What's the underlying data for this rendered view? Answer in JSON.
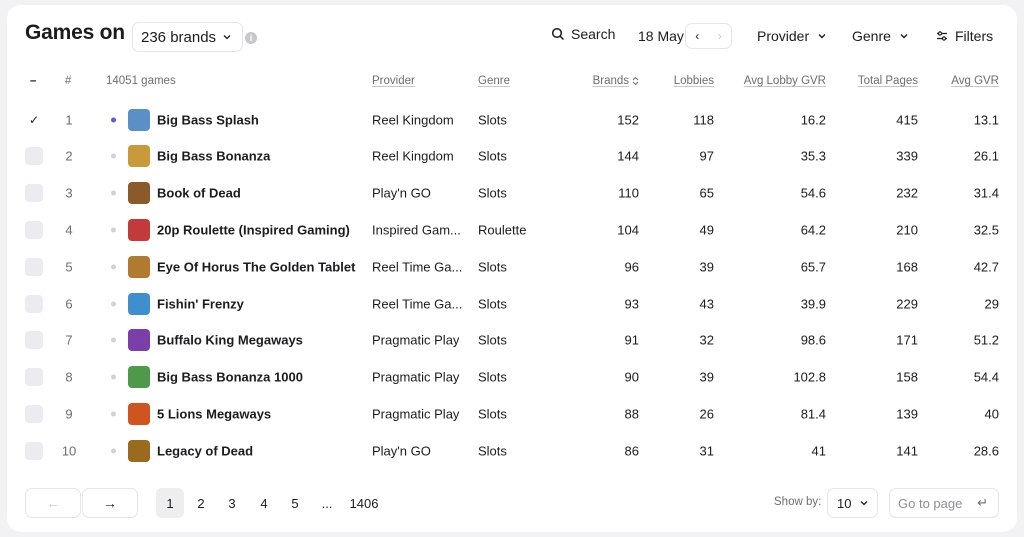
{
  "header": {
    "title": "Games on",
    "brand_select": "236 brands",
    "info_glyph": "i",
    "search_label": "Search",
    "date": "18 May",
    "date_prev": "‹",
    "date_next": "›",
    "provider_label": "Provider",
    "genre_label": "Genre",
    "filters_label": "Filters"
  },
  "table": {
    "columns": {
      "select": "–",
      "rank": "#",
      "games": "14051 games",
      "provider": "Provider",
      "genre": "Genre",
      "brands": "Brands",
      "lobbies": "Lobbies",
      "avg_lobby_gvr": "Avg Lobby GVR",
      "total_pages": "Total Pages",
      "avg_gvr": "Avg GVR"
    },
    "rows": [
      {
        "rank": "1",
        "name": "Big Bass Splash",
        "provider": "Reel Kingdom",
        "genre": "Slots",
        "brands": "152",
        "lobbies": "118",
        "avg_lobby_gvr": "16.2",
        "total_pages": "415",
        "avg_gvr": "13.1",
        "selected": true,
        "thumb": "#5a8fc7"
      },
      {
        "rank": "2",
        "name": "Big Bass Bonanza",
        "provider": "Reel Kingdom",
        "genre": "Slots",
        "brands": "144",
        "lobbies": "97",
        "avg_lobby_gvr": "35.3",
        "total_pages": "339",
        "avg_gvr": "26.1",
        "selected": false,
        "thumb": "#c89a3a"
      },
      {
        "rank": "3",
        "name": "Book of Dead",
        "provider": "Play'n GO",
        "genre": "Slots",
        "brands": "110",
        "lobbies": "65",
        "avg_lobby_gvr": "54.6",
        "total_pages": "232",
        "avg_gvr": "31.4",
        "selected": false,
        "thumb": "#8a5a2a"
      },
      {
        "rank": "4",
        "name": "20p Roulette (Inspired Gaming)",
        "provider": "Inspired Gam...",
        "genre": "Roulette",
        "brands": "104",
        "lobbies": "49",
        "avg_lobby_gvr": "64.2",
        "total_pages": "210",
        "avg_gvr": "32.5",
        "selected": false,
        "thumb": "#c23a3a"
      },
      {
        "rank": "5",
        "name": "Eye Of Horus The Golden Tablet",
        "provider": "Reel Time Ga...",
        "genre": "Slots",
        "brands": "96",
        "lobbies": "39",
        "avg_lobby_gvr": "65.7",
        "total_pages": "168",
        "avg_gvr": "42.7",
        "selected": false,
        "thumb": "#b07a30"
      },
      {
        "rank": "6",
        "name": "Fishin' Frenzy",
        "provider": "Reel Time Ga...",
        "genre": "Slots",
        "brands": "93",
        "lobbies": "43",
        "avg_lobby_gvr": "39.9",
        "total_pages": "229",
        "avg_gvr": "29",
        "selected": false,
        "thumb": "#3f8fcf"
      },
      {
        "rank": "7",
        "name": "Buffalo King Megaways",
        "provider": "Pragmatic Play",
        "genre": "Slots",
        "brands": "91",
        "lobbies": "32",
        "avg_lobby_gvr": "98.6",
        "total_pages": "171",
        "avg_gvr": "51.2",
        "selected": false,
        "thumb": "#7a3fa8"
      },
      {
        "rank": "8",
        "name": "Big Bass Bonanza 1000",
        "provider": "Pragmatic Play",
        "genre": "Slots",
        "brands": "90",
        "lobbies": "39",
        "avg_lobby_gvr": "102.8",
        "total_pages": "158",
        "avg_gvr": "54.4",
        "selected": false,
        "thumb": "#4f9a4a"
      },
      {
        "rank": "9",
        "name": "5 Lions Megaways",
        "provider": "Pragmatic Play",
        "genre": "Slots",
        "brands": "88",
        "lobbies": "26",
        "avg_lobby_gvr": "81.4",
        "total_pages": "139",
        "avg_gvr": "40",
        "selected": false,
        "thumb": "#d0541f"
      },
      {
        "rank": "10",
        "name": "Legacy of Dead",
        "provider": "Play'n GO",
        "genre": "Slots",
        "brands": "86",
        "lobbies": "31",
        "avg_lobby_gvr": "41",
        "total_pages": "141",
        "avg_gvr": "28.6",
        "selected": false,
        "thumb": "#9a6a1e"
      }
    ]
  },
  "pagination": {
    "prev": "←",
    "next": "→",
    "pages": [
      "1",
      "2",
      "3",
      "4",
      "5",
      "...",
      "1406"
    ],
    "current": "1",
    "show_by_label": "Show by:",
    "per_page": "10",
    "goto_placeholder": "Go to page",
    "goto_glyph": "↵"
  },
  "colors": {
    "accent_dot": "#5b5bdc",
    "inactive_dot": "#d1d1d6",
    "checkbox": "#ececf0"
  },
  "icons": {
    "search": "search-icon",
    "chevron": "chevron-down-icon",
    "filters": "sliders-icon",
    "sort": "sort-icon",
    "enter": "enter-icon"
  }
}
